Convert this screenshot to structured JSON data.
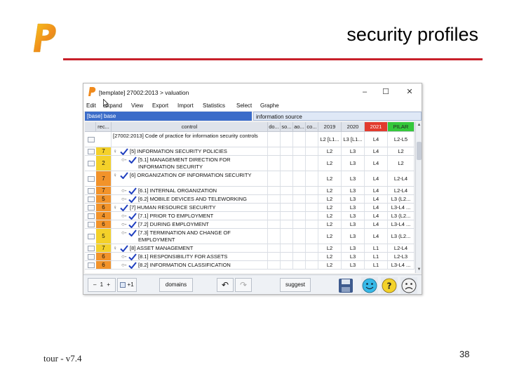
{
  "slide": {
    "title": "security profiles",
    "footer": "tour - v7.4",
    "page_number": "38",
    "accent_color": "#c8202a"
  },
  "window": {
    "title": "[template] 27002:2013 > valuation",
    "controls": {
      "minimize": "–",
      "maximize": "☐",
      "close": "✕"
    }
  },
  "menu": [
    "Edit",
    "Expand",
    "View",
    "Export",
    "Import",
    "Statistics",
    "Select",
    "Graphe"
  ],
  "filter": {
    "value": "[base] base",
    "info": "information source"
  },
  "columns": {
    "rec": "rec...",
    "control": "control",
    "do": "do...",
    "so": "so...",
    "ao": "ao...",
    "co": "co...",
    "c2019": "2019",
    "c2020": "2020",
    "c2021": "2021",
    "pilar": "PILAR"
  },
  "column_colors": {
    "c2021": "#e23b2e",
    "pilar": "#35c83a"
  },
  "rows": [
    {
      "rec": "",
      "recColor": "",
      "expand": "",
      "icon": "",
      "indent": 0,
      "control": "[27002:2013] Code of practice for information security controls",
      "c2019": "L2 [L1...",
      "c2020": "L3 [L1...",
      "c2021": "L4",
      "pilar": "L2-L5",
      "lines": 2
    },
    {
      "rec": "7",
      "recColor": "#f4d12a",
      "expand": "♀",
      "icon": "check",
      "indent": 1,
      "control": "[5] INFORMATION SECURITY POLICIES",
      "c2019": "L2",
      "c2020": "L3",
      "c2021": "L4",
      "pilar": "L2",
      "lines": 1
    },
    {
      "rec": "2",
      "recColor": "#f4d12a",
      "expand": "○-",
      "icon": "check",
      "indent": 2,
      "control": "[5.1] MANAGEMENT DIRECTION FOR INFORMATION SECURITY",
      "c2019": "L2",
      "c2020": "L3",
      "c2021": "L4",
      "pilar": "L2",
      "lines": 2
    },
    {
      "rec": "7",
      "recColor": "#f2932a",
      "expand": "♀",
      "icon": "check",
      "indent": 1,
      "control": "[6] ORGANIZATION OF INFORMATION SECURITY",
      "c2019": "L2",
      "c2020": "L3",
      "c2021": "L4",
      "pilar": "L2-L4",
      "lines": 2
    },
    {
      "rec": "7",
      "recColor": "#f2932a",
      "expand": "○-",
      "icon": "check",
      "indent": 2,
      "control": "[6.1] INTERNAL ORGANIZATION",
      "c2019": "L2",
      "c2020": "L3",
      "c2021": "L4",
      "pilar": "L2-L4",
      "lines": 1
    },
    {
      "rec": "5",
      "recColor": "#f2932a",
      "expand": "○-",
      "icon": "check",
      "indent": 2,
      "control": "[6.2] MOBILE DEVICES AND TELEWORKING",
      "c2019": "L2",
      "c2020": "L3",
      "c2021": "L4",
      "pilar": "L3 (L2...",
      "lines": 1
    },
    {
      "rec": "6",
      "recColor": "#f2932a",
      "expand": "♀",
      "icon": "check",
      "indent": 1,
      "control": "[7] HUMAN RESOURCE SECURITY",
      "c2019": "L2",
      "c2020": "L3",
      "c2021": "L4",
      "pilar": "L3-L4 ...",
      "lines": 1
    },
    {
      "rec": "4",
      "recColor": "#f2932a",
      "expand": "○-",
      "icon": "check",
      "indent": 2,
      "control": "[7.1] PRIOR TO EMPLOYMENT",
      "c2019": "L2",
      "c2020": "L3",
      "c2021": "L4",
      "pilar": "L3 (L2...",
      "lines": 1
    },
    {
      "rec": "6",
      "recColor": "#f2932a",
      "expand": "○-",
      "icon": "check",
      "indent": 2,
      "control": "[7.2] DURING EMPLOYMENT",
      "c2019": "L2",
      "c2020": "L3",
      "c2021": "L4",
      "pilar": "L3-L4 ...",
      "lines": 1
    },
    {
      "rec": "5",
      "recColor": "#f4d12a",
      "expand": "○-",
      "icon": "check",
      "indent": 2,
      "control": "[7.3] TERMINATION AND CHANGE OF EMPLOYMENT",
      "c2019": "L2",
      "c2020": "L3",
      "c2021": "L4",
      "pilar": "L3 (L2...",
      "lines": 2
    },
    {
      "rec": "7",
      "recColor": "#f4d12a",
      "expand": "♀",
      "icon": "check",
      "indent": 1,
      "control": "[8] ASSET MANAGEMENT",
      "c2019": "L2",
      "c2020": "L3",
      "c2021": "L1",
      "pilar": "L2-L4",
      "lines": 1
    },
    {
      "rec": "6",
      "recColor": "#f2932a",
      "expand": "○-",
      "icon": "check",
      "indent": 2,
      "control": "[8.1] RESPONSIBILITY FOR ASSETS",
      "c2019": "L2",
      "c2020": "L3",
      "c2021": "L1",
      "pilar": "L2-L3",
      "lines": 1
    },
    {
      "rec": "6",
      "recColor": "#f2932a",
      "expand": "○-",
      "icon": "check",
      "indent": 2,
      "control": "[8.2] INFORMATION CLASSIFICATION",
      "c2019": "L2",
      "c2020": "L3",
      "c2021": "L1",
      "pilar": "L3-L4 ...",
      "lines": 1
    }
  ],
  "toolbar": {
    "level_value": "1",
    "plus_label": "+1",
    "domains": "domains",
    "undo": "↶",
    "redo": "↷",
    "suggest": "suggest"
  }
}
